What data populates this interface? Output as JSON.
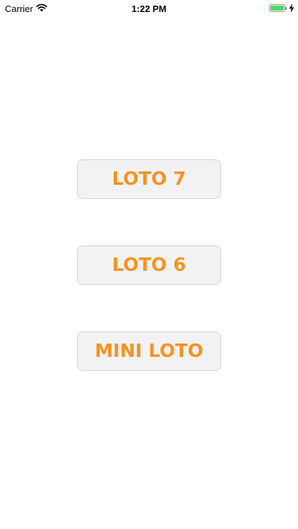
{
  "status_bar": {
    "carrier": "Carrier",
    "time": "1:22 PM",
    "battery_level": 1.0,
    "charging": true
  },
  "menu": {
    "buttons": [
      {
        "label": "LOTO 7"
      },
      {
        "label": "LOTO 6"
      },
      {
        "label": "MINI LOTO"
      }
    ]
  },
  "colors": {
    "accent": "#f7931e",
    "button_background": "#f2f2f5",
    "button_border": "#d3d3d8",
    "battery": "#4cd964"
  }
}
